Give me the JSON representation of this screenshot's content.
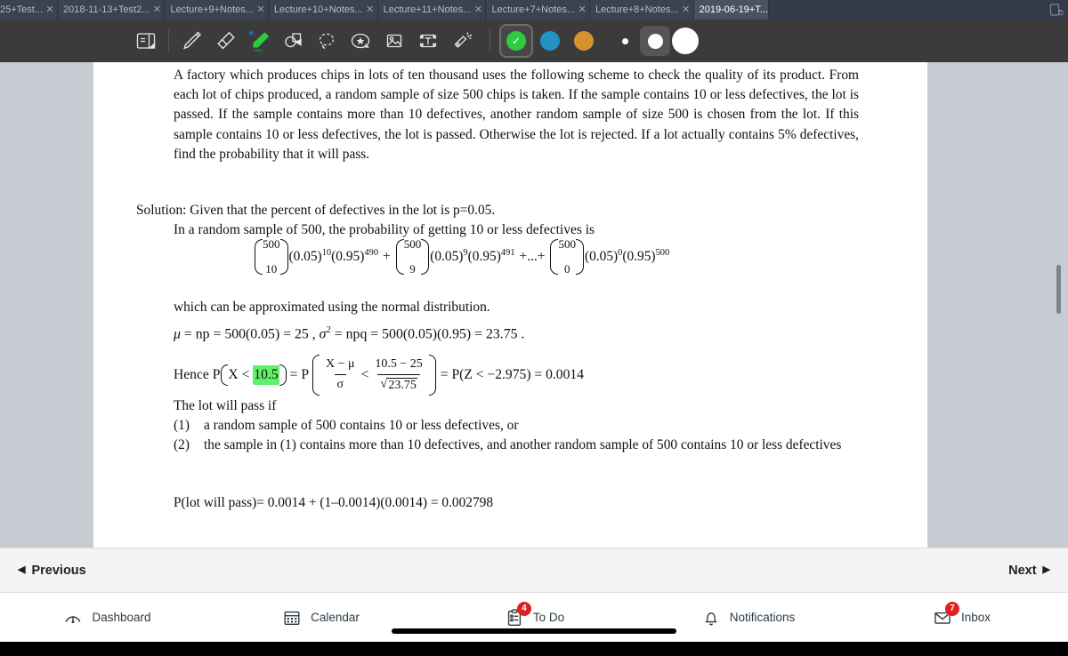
{
  "window": {
    "tabs": [
      {
        "label": "25+Test...",
        "active": false,
        "close_icon": "close-icon"
      },
      {
        "label": "2018-11-13+Test2...",
        "active": false,
        "close_icon": "close-icon"
      },
      {
        "label": "Lecture+9+Notes...",
        "active": false,
        "close_icon": "close-icon"
      },
      {
        "label": "Lecture+10+Notes...",
        "active": false,
        "close_icon": "close-icon"
      },
      {
        "label": "Lecture+11+Notes...",
        "active": false,
        "close_icon": "close-icon"
      },
      {
        "label": "Lecture+7+Notes...",
        "active": false,
        "close_icon": "close-icon"
      },
      {
        "label": "Lecture+8+Notes...",
        "active": false,
        "close_icon": "close-icon"
      },
      {
        "label": "2019-06-19+T...",
        "active": true,
        "close_icon": "close-icon"
      }
    ],
    "new_tab_icon": "new-tab-icon"
  },
  "toolbar": {
    "tools": [
      {
        "name": "page-panel-icon",
        "selected": false
      },
      {
        "name": "pen-icon",
        "selected": false
      },
      {
        "name": "eraser-icon",
        "selected": false
      },
      {
        "name": "highlighter-icon",
        "selected": true,
        "bluetooth": true
      },
      {
        "name": "shapes-icon",
        "selected": false
      },
      {
        "name": "lasso-icon",
        "selected": false
      },
      {
        "name": "sticker-star-icon",
        "selected": false
      },
      {
        "name": "image-icon",
        "selected": false
      },
      {
        "name": "text-box-icon",
        "selected": false
      },
      {
        "name": "laser-pointer-icon",
        "selected": false
      }
    ],
    "colors": [
      {
        "name": "color-swatch-green",
        "hex": "#2ecb3f",
        "selected": true
      },
      {
        "name": "color-swatch-blue",
        "hex": "#2193c4",
        "selected": false
      },
      {
        "name": "color-swatch-orange",
        "hex": "#d8912f",
        "selected": false
      }
    ],
    "widths": [
      {
        "name": "stroke-width-small",
        "size": 7,
        "selected": false
      },
      {
        "name": "stroke-width-medium",
        "size": 17,
        "selected": true
      },
      {
        "name": "stroke-width-large",
        "size": 30,
        "selected": false
      }
    ],
    "accent_green": "#2ecb3f",
    "highlight_color": "#5ff06a"
  },
  "document": {
    "problem": "A factory which produces chips in lots of ten thousand uses the following scheme to check the quality of its product.  From each lot of chips produced, a random sample of size 500 chips is taken.  If the sample contains 10 or less defectives, the lot is passed.  If the sample contains more than 10 defectives, another random sample of size 500 is chosen from the lot.  If this sample contains 10 or less defectives, the lot is passed.  Otherwise the lot is rejected.  If a lot actually contains 5% defectives, find the probability that it will pass.",
    "solution_intro": "Solution:  Given that the percent of defectives in the lot is p=0.05.",
    "solution_line2": "In a random sample of 500, the probability of getting 10 or less defectives is",
    "formula": {
      "term1": {
        "n": "500",
        "k": "10",
        "p_base": "(0.05)",
        "p_exp": "10",
        "q_base": "(0.95)",
        "q_exp": "490"
      },
      "term2": {
        "n": "500",
        "k": "9",
        "p_base": "(0.05)",
        "p_exp": "9",
        "q_base": "(0.95)",
        "q_exp": "491"
      },
      "term3": {
        "n": "500",
        "k": "0",
        "p_base": "(0.05)",
        "p_exp": "0",
        "q_base": "(0.95)",
        "q_exp": "500"
      },
      "plus": "+",
      "ellipsis_plus": "+...+"
    },
    "approx_line": "which can be approximated using the normal distribution.",
    "mu_sigma": {
      "mu": "μ",
      "mu_expr": " = np = 500(0.05) = 25 ,  ",
      "sigma": "σ",
      "sigma_exp": "2",
      "sigma_expr": " = npq = 500(0.05)(0.95) = 23.75 ."
    },
    "hence": {
      "prefix": "Hence  P",
      "open": "(",
      "x_lt": "X <",
      "highlighted_value": "10.5",
      "close": ")",
      "eq_p": "= P",
      "num_left": "X − μ",
      "den_left": "σ",
      "lt": "<",
      "num_right": "10.5 − 25",
      "den_right": "23.75",
      "sqrt_symbol": "√",
      "tail": "= P(Z < −2.975) = 0.0014"
    },
    "lot_will_pass_heading": "The lot will pass if",
    "lot_items": [
      {
        "num": "(1)",
        "text": "a random sample of 500 contains 10 or less defectives, or"
      },
      {
        "num": "(2)",
        "text": "the sample in (1) contains more than 10 defectives, and another random sample of 500 contains 10 or less defectives"
      }
    ],
    "final_line": "P(lot will pass)= 0.0014 + (1–0.0014)(0.0014) = 0.002798"
  },
  "navbar": {
    "previous_label": "Previous",
    "previous_icon": "chevron-left-icon",
    "next_label": "Next",
    "next_icon": "chevron-right-icon"
  },
  "dock": {
    "items": [
      {
        "label": "Dashboard",
        "icon": "dashboard-speedometer-icon",
        "badge": null
      },
      {
        "label": "Calendar",
        "icon": "calendar-icon",
        "badge": null
      },
      {
        "label": "To Do",
        "icon": "todo-clipboard-icon",
        "badge": "4"
      },
      {
        "label": "Notifications",
        "icon": "bell-icon",
        "badge": null
      },
      {
        "label": "Inbox",
        "icon": "envelope-icon",
        "badge": "7"
      }
    ],
    "badge_color": "#e02020",
    "home_indicator": "home-indicator"
  }
}
